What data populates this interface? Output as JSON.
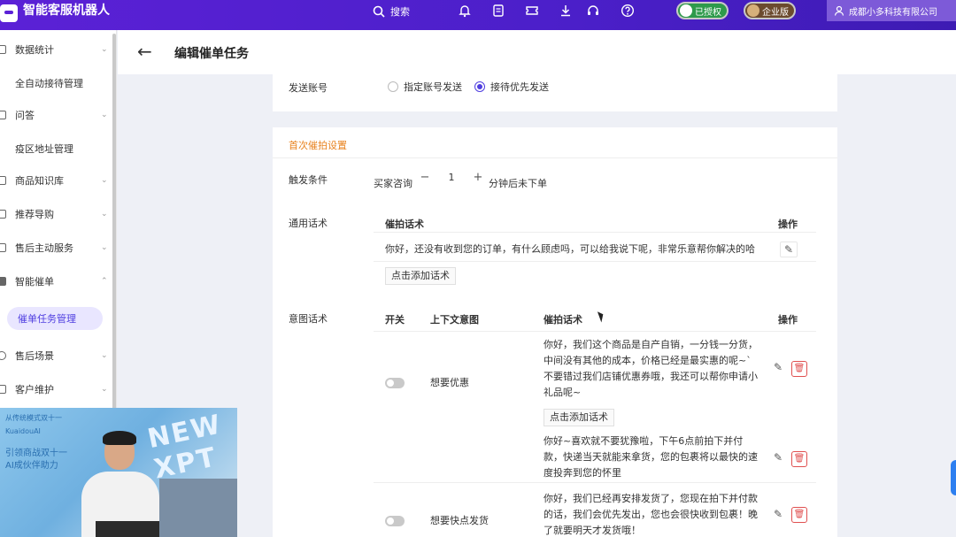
{
  "app": {
    "title": "智能客服机器人"
  },
  "topbar": {
    "search_label": "搜索",
    "badge_authorized": "已授权",
    "badge_enterprise": "企业版",
    "company": "成都小多科技有限公司"
  },
  "sidebar": {
    "items": [
      {
        "label": "数据统计"
      },
      {
        "label": "全自动接待管理"
      },
      {
        "label": "问答"
      },
      {
        "label": "疫区地址管理"
      },
      {
        "label": "商品知识库"
      },
      {
        "label": "推荐导购"
      },
      {
        "label": "售后主动服务"
      },
      {
        "label": "智能催单"
      },
      {
        "label": "催单任务管理"
      },
      {
        "label": "售后场景"
      },
      {
        "label": "客户维护"
      }
    ]
  },
  "header": {
    "back": "←",
    "title": "编辑催单任务"
  },
  "send_account": {
    "label": "发送账号",
    "option_designated": "指定账号发送",
    "option_reception": "接待优先发送",
    "selected": "接待优先发送"
  },
  "first_reminder": {
    "section_title": "首次催拍设置",
    "trigger_label": "触发条件",
    "trigger_prefix": "买家咨询",
    "minus": "−",
    "trigger_value": "1",
    "plus": "+",
    "trigger_suffix": "分钟后未下单",
    "general_label": "通用话术",
    "general_col_script": "催拍话术",
    "general_col_action": "操作",
    "general_script": "你好，还没有收到您的订单，有什么顾虑吗，可以给我说下呢，非常乐意帮你解决的哈",
    "add_script": "点击添加话术",
    "intent_label": "意图话术",
    "intent_col_switch": "开关",
    "intent_col_context": "上下文意图",
    "intent_col_script": "催拍话术",
    "intent_col_action": "操作",
    "intents": [
      {
        "name": "想要优惠",
        "scripts": [
          [
            "你好，我们这个商品是自产自销，一分钱一分货，",
            "中间没有其他的成本，价格已经是最实惠的呢~`",
            "不要错过我们店铺优惠券哦，我还可以帮你申请小",
            "礼品呢~"
          ],
          [
            "你好~喜欢就不要犹豫啦，下午6点前拍下并付",
            "款，快递当天就能来拿货，您的包裹将以最快的速",
            "度投奔到您的怀里"
          ]
        ]
      },
      {
        "name": "想要快点发货",
        "scripts": [
          [
            "你好，我们已经再安排发货了，您现在拍下并付款",
            "的话，我们会优先发出，您也会很快收到包裹！晚",
            "了就要明天才发货哦！"
          ]
        ]
      }
    ]
  },
  "webcam": {
    "line1": "从传统模式双十一",
    "line2": "KuaidouAI",
    "line3": "引领商战双十一",
    "line4": "AI成伙伴助力",
    "big": "NEW XPT"
  }
}
